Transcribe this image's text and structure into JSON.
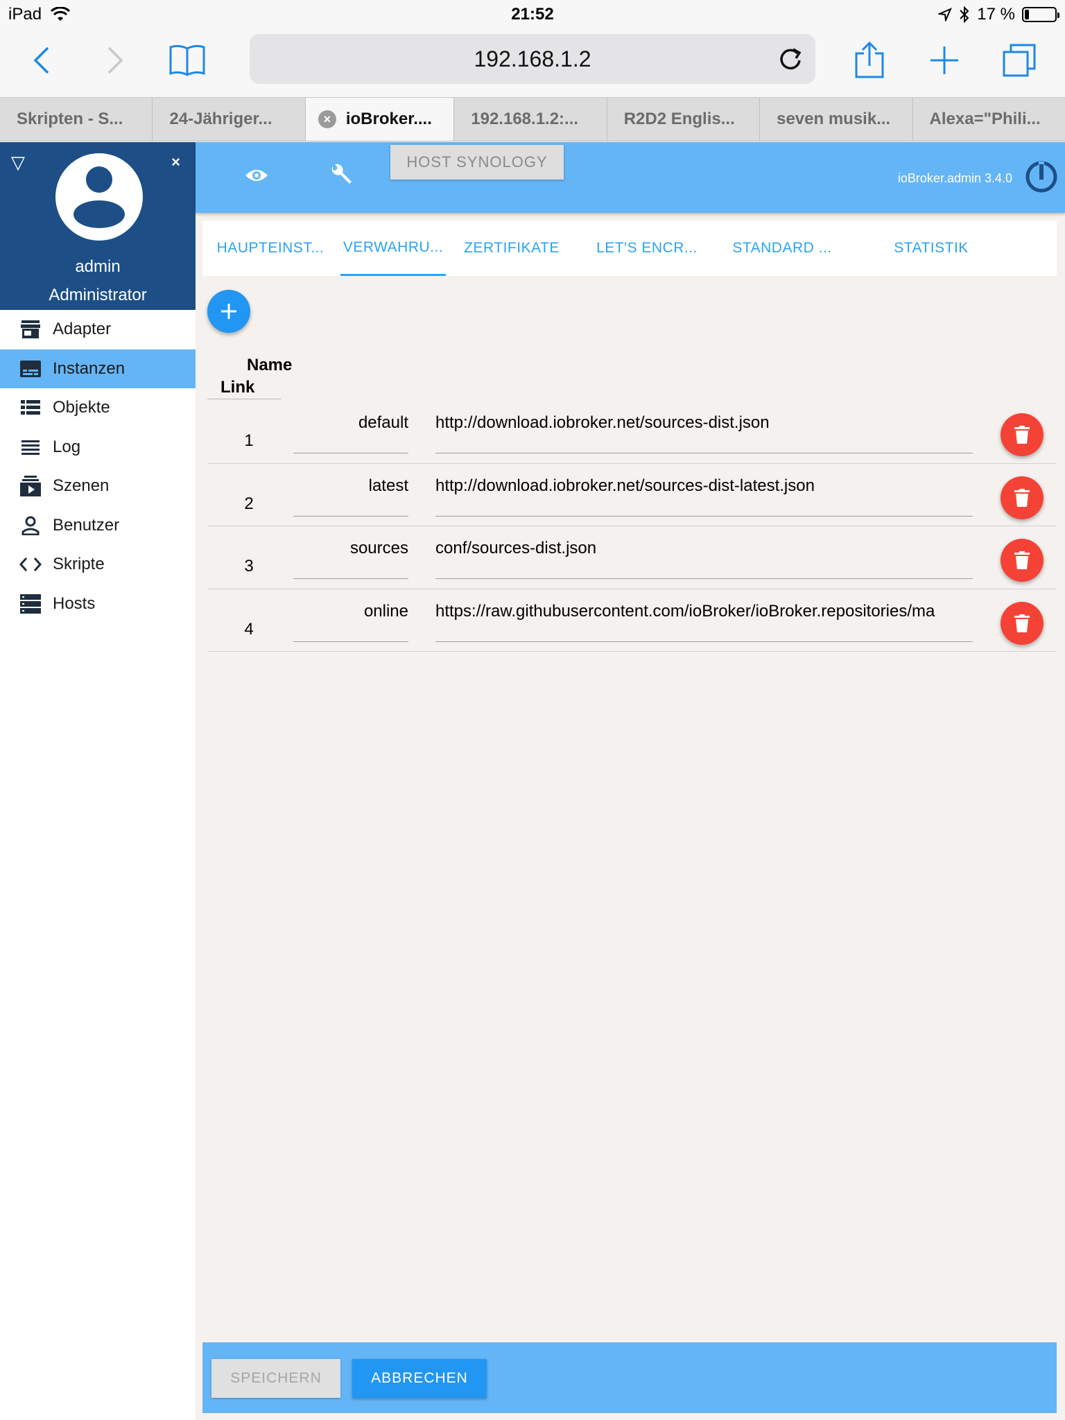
{
  "status_bar": {
    "device": "iPad",
    "time": "21:52",
    "battery": "17 %"
  },
  "browser": {
    "url": "192.168.1.2",
    "tabs": [
      {
        "label": "Skripten - S..."
      },
      {
        "label": "24-Jähriger..."
      },
      {
        "label": "ioBroker...."
      },
      {
        "label": "192.168.1.2:..."
      },
      {
        "label": "R2D2 Englis..."
      },
      {
        "label": "seven musik..."
      },
      {
        "label": "Alexa=\"Phili..."
      }
    ]
  },
  "sidebar": {
    "user": "admin",
    "role": "Administrator",
    "items": [
      {
        "label": "Adapter",
        "icon": "store-icon"
      },
      {
        "label": "Instanzen",
        "icon": "instances-icon"
      },
      {
        "label": "Objekte",
        "icon": "list-icon"
      },
      {
        "label": "Log",
        "icon": "log-icon"
      },
      {
        "label": "Szenen",
        "icon": "scenes-icon"
      },
      {
        "label": "Benutzer",
        "icon": "user-icon"
      },
      {
        "label": "Skripte",
        "icon": "code-icon"
      },
      {
        "label": "Hosts",
        "icon": "hosts-icon"
      }
    ]
  },
  "header": {
    "host_button": "HOST SYNOLOGY",
    "version": "ioBroker.admin 3.4.0"
  },
  "tabs": [
    {
      "label": "HAUPTEINST..."
    },
    {
      "label": "VERWAHRU..."
    },
    {
      "label": "ZERTIFIKATE"
    },
    {
      "label": "LET'S ENCR..."
    },
    {
      "label": "STANDARD ..."
    },
    {
      "label": "STATISTIK"
    }
  ],
  "table": {
    "header_name": "Name",
    "header_link": "Link",
    "rows": [
      {
        "num": "1",
        "name": "default",
        "link": "http://download.iobroker.net/sources-dist.json"
      },
      {
        "num": "2",
        "name": "latest",
        "link": "http://download.iobroker.net/sources-dist-latest.json"
      },
      {
        "num": "3",
        "name": "sources",
        "link": "conf/sources-dist.json"
      },
      {
        "num": "4",
        "name": "online",
        "link": "https://raw.githubusercontent.com/ioBroker/ioBroker.repositories/ma"
      }
    ]
  },
  "footer": {
    "save": "SPEICHERN",
    "cancel": "ABBRECHEN"
  },
  "colors": {
    "appbar": "#64b5f6",
    "sidebar_header": "#1d4f86",
    "accent": "#2196f3",
    "delete": "#f44336"
  }
}
